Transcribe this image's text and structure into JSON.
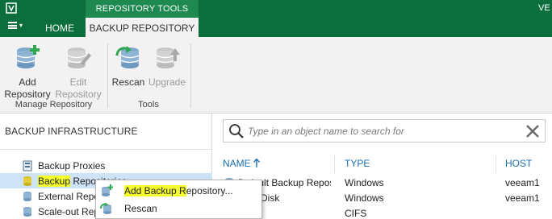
{
  "titlebar": {
    "context_tab_group": "REPOSITORY TOOLS",
    "window_title_fragment": "VE"
  },
  "tabs": {
    "menu_icon": "hamburger-menu-icon",
    "home": "HOME",
    "backup_repository": "BACKUP REPOSITORY"
  },
  "ribbon": {
    "add_repository": {
      "line1": "Add",
      "line2": "Repository",
      "icon": "add-repository-icon"
    },
    "edit_repository": {
      "line1": "Edit",
      "line2": "Repository",
      "icon": "edit-repository-icon",
      "enabled": false
    },
    "manage_group_label": "Manage Repository",
    "rescan": {
      "label": "Rescan",
      "icon": "rescan-icon"
    },
    "upgrade": {
      "label": "Upgrade",
      "icon": "upgrade-icon",
      "enabled": false
    },
    "tools_group_label": "Tools"
  },
  "left_pane": {
    "header": "BACKUP INFRASTRUCTURE",
    "items": [
      {
        "label": "Backup Proxies",
        "icon": "proxy-icon"
      },
      {
        "label_highlight": "Backup",
        "label_rest": " Repositories",
        "icon": "repository-icon",
        "selected": true
      },
      {
        "label": "External Repositories",
        "icon": "external-repository-icon"
      },
      {
        "label": "Scale-out Repositories",
        "icon": "scaleout-repository-icon"
      }
    ]
  },
  "search": {
    "placeholder": "Type in an object name to search for",
    "icon": "search-icon",
    "clear_icon": "close-icon"
  },
  "table": {
    "columns": {
      "name": "NAME",
      "type": "TYPE",
      "host": "HOST"
    },
    "sort": {
      "column": "name",
      "direction": "ascending",
      "icon": "sort-up-arrow-icon"
    },
    "rows": [
      {
        "name": "Default Backup Repository",
        "type": "Windows",
        "host": "veeam1"
      },
      {
        "name": "Usb_Disk",
        "type": "Windows",
        "host": "veeam1"
      },
      {
        "name": "",
        "type": "CIFS",
        "host": ""
      }
    ]
  },
  "context_menu": {
    "items": [
      {
        "label_highlight": "Add Backup R",
        "label_rest": "epository...",
        "icon": "add-repository-icon"
      },
      {
        "label": "Rescan",
        "icon": "rescan-icon"
      }
    ]
  },
  "colors": {
    "title_green": "#0b6e3c",
    "context_green": "#1e8a52",
    "ribbon_bg": "#f2f2f2",
    "selection_blue": "#cfe3f7",
    "highlight_yellow": "#f5ff2a",
    "link_blue": "#1b6fb1"
  }
}
